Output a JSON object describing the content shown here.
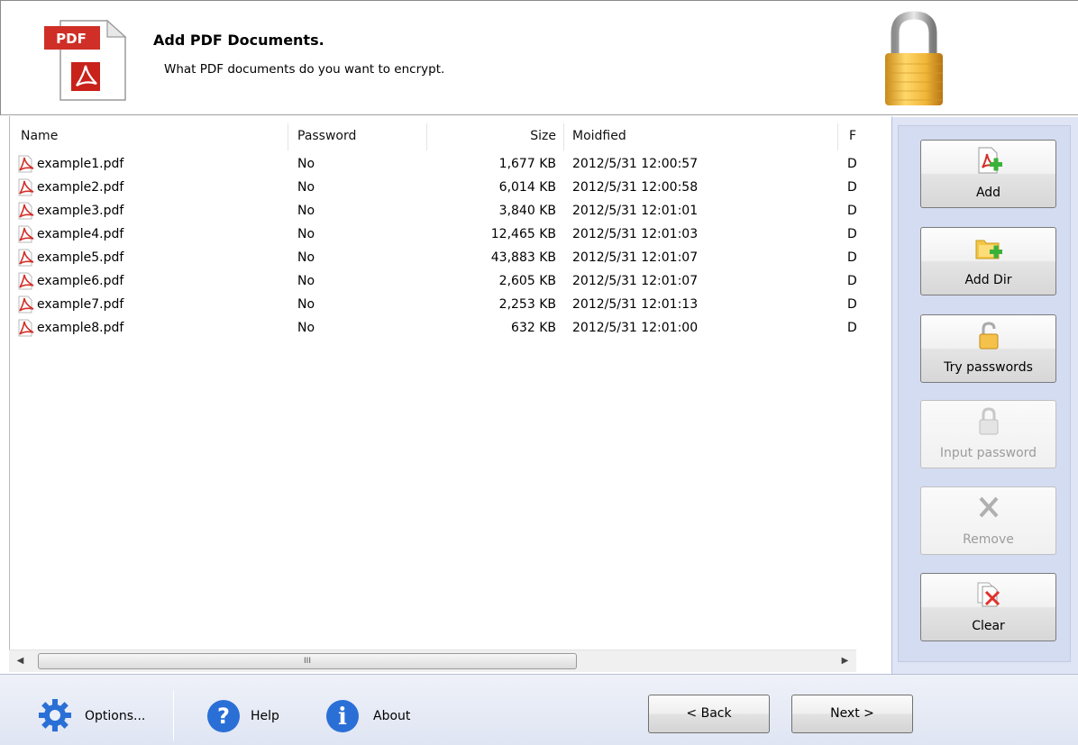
{
  "header": {
    "title": "Add PDF Documents.",
    "subtitle": "What PDF documents do you want to encrypt.",
    "pdf_icon_text": "PDF"
  },
  "list": {
    "columns": [
      "Name",
      "Password",
      "Size",
      "Moidfied",
      "F"
    ],
    "rows": [
      {
        "name": "example1.pdf",
        "password": "No",
        "size": "1,677 KB",
        "modified": "2012/5/31 12:00:57",
        "f": "D"
      },
      {
        "name": "example2.pdf",
        "password": "No",
        "size": "6,014 KB",
        "modified": "2012/5/31 12:00:58",
        "f": "D"
      },
      {
        "name": "example3.pdf",
        "password": "No",
        "size": "3,840 KB",
        "modified": "2012/5/31 12:01:01",
        "f": "D"
      },
      {
        "name": "example4.pdf",
        "password": "No",
        "size": "12,465 KB",
        "modified": "2012/5/31 12:01:03",
        "f": "D"
      },
      {
        "name": "example5.pdf",
        "password": "No",
        "size": "43,883 KB",
        "modified": "2012/5/31 12:01:07",
        "f": "D"
      },
      {
        "name": "example6.pdf",
        "password": "No",
        "size": "2,605 KB",
        "modified": "2012/5/31 12:01:07",
        "f": "D"
      },
      {
        "name": "example7.pdf",
        "password": "No",
        "size": "2,253 KB",
        "modified": "2012/5/31 12:01:13",
        "f": "D"
      },
      {
        "name": "example8.pdf",
        "password": "No",
        "size": "632 KB",
        "modified": "2012/5/31 12:01:00",
        "f": "D"
      }
    ],
    "scroll_thumb_grip": "III",
    "scroll_left": "◀",
    "scroll_right": "▶"
  },
  "side": {
    "add_label": "Add",
    "add_dir_label": "Add Dir",
    "try_passwords_label": "Try passwords",
    "input_password_label": "Input password",
    "remove_label": "Remove",
    "clear_label": "Clear"
  },
  "bottom": {
    "options_label": "Options...",
    "help_label": "Help",
    "about_label": "About",
    "back_label": "< Back",
    "next_label": "Next >"
  },
  "colors": {
    "accent_blue": "#2a6fd6",
    "pdf_red": "#d0302a",
    "side_panel_bg": "#dfe5f5"
  },
  "icons": [
    "pdf-document-icon",
    "padlock-icon",
    "pdf-file-icon",
    "add-file-icon",
    "add-folder-icon",
    "open-lock-icon",
    "lock-icon",
    "remove-x-icon",
    "clear-icon",
    "gear-icon",
    "help-icon",
    "info-icon"
  ]
}
